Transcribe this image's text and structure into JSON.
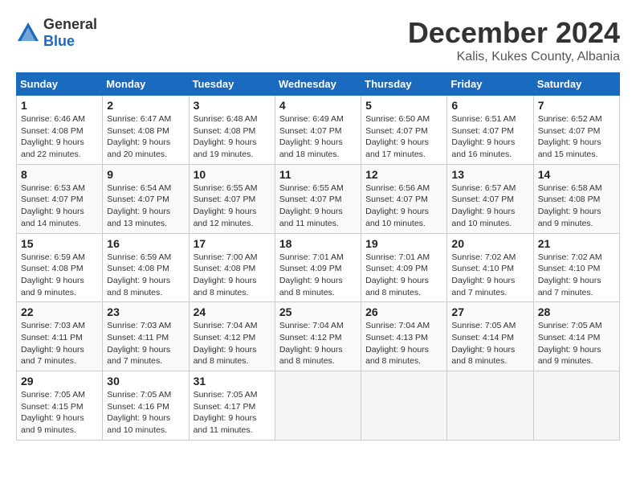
{
  "logo": {
    "general": "General",
    "blue": "Blue"
  },
  "title": {
    "month": "December 2024",
    "location": "Kalis, Kukes County, Albania"
  },
  "calendar": {
    "headers": [
      "Sunday",
      "Monday",
      "Tuesday",
      "Wednesday",
      "Thursday",
      "Friday",
      "Saturday"
    ],
    "rows": [
      [
        {
          "day": "1",
          "sunrise": "Sunrise: 6:46 AM",
          "sunset": "Sunset: 4:08 PM",
          "daylight": "Daylight: 9 hours and 22 minutes."
        },
        {
          "day": "2",
          "sunrise": "Sunrise: 6:47 AM",
          "sunset": "Sunset: 4:08 PM",
          "daylight": "Daylight: 9 hours and 20 minutes."
        },
        {
          "day": "3",
          "sunrise": "Sunrise: 6:48 AM",
          "sunset": "Sunset: 4:08 PM",
          "daylight": "Daylight: 9 hours and 19 minutes."
        },
        {
          "day": "4",
          "sunrise": "Sunrise: 6:49 AM",
          "sunset": "Sunset: 4:07 PM",
          "daylight": "Daylight: 9 hours and 18 minutes."
        },
        {
          "day": "5",
          "sunrise": "Sunrise: 6:50 AM",
          "sunset": "Sunset: 4:07 PM",
          "daylight": "Daylight: 9 hours and 17 minutes."
        },
        {
          "day": "6",
          "sunrise": "Sunrise: 6:51 AM",
          "sunset": "Sunset: 4:07 PM",
          "daylight": "Daylight: 9 hours and 16 minutes."
        },
        {
          "day": "7",
          "sunrise": "Sunrise: 6:52 AM",
          "sunset": "Sunset: 4:07 PM",
          "daylight": "Daylight: 9 hours and 15 minutes."
        }
      ],
      [
        {
          "day": "8",
          "sunrise": "Sunrise: 6:53 AM",
          "sunset": "Sunset: 4:07 PM",
          "daylight": "Daylight: 9 hours and 14 minutes."
        },
        {
          "day": "9",
          "sunrise": "Sunrise: 6:54 AM",
          "sunset": "Sunset: 4:07 PM",
          "daylight": "Daylight: 9 hours and 13 minutes."
        },
        {
          "day": "10",
          "sunrise": "Sunrise: 6:55 AM",
          "sunset": "Sunset: 4:07 PM",
          "daylight": "Daylight: 9 hours and 12 minutes."
        },
        {
          "day": "11",
          "sunrise": "Sunrise: 6:55 AM",
          "sunset": "Sunset: 4:07 PM",
          "daylight": "Daylight: 9 hours and 11 minutes."
        },
        {
          "day": "12",
          "sunrise": "Sunrise: 6:56 AM",
          "sunset": "Sunset: 4:07 PM",
          "daylight": "Daylight: 9 hours and 10 minutes."
        },
        {
          "day": "13",
          "sunrise": "Sunrise: 6:57 AM",
          "sunset": "Sunset: 4:07 PM",
          "daylight": "Daylight: 9 hours and 10 minutes."
        },
        {
          "day": "14",
          "sunrise": "Sunrise: 6:58 AM",
          "sunset": "Sunset: 4:08 PM",
          "daylight": "Daylight: 9 hours and 9 minutes."
        }
      ],
      [
        {
          "day": "15",
          "sunrise": "Sunrise: 6:59 AM",
          "sunset": "Sunset: 4:08 PM",
          "daylight": "Daylight: 9 hours and 9 minutes."
        },
        {
          "day": "16",
          "sunrise": "Sunrise: 6:59 AM",
          "sunset": "Sunset: 4:08 PM",
          "daylight": "Daylight: 9 hours and 8 minutes."
        },
        {
          "day": "17",
          "sunrise": "Sunrise: 7:00 AM",
          "sunset": "Sunset: 4:08 PM",
          "daylight": "Daylight: 9 hours and 8 minutes."
        },
        {
          "day": "18",
          "sunrise": "Sunrise: 7:01 AM",
          "sunset": "Sunset: 4:09 PM",
          "daylight": "Daylight: 9 hours and 8 minutes."
        },
        {
          "day": "19",
          "sunrise": "Sunrise: 7:01 AM",
          "sunset": "Sunset: 4:09 PM",
          "daylight": "Daylight: 9 hours and 8 minutes."
        },
        {
          "day": "20",
          "sunrise": "Sunrise: 7:02 AM",
          "sunset": "Sunset: 4:10 PM",
          "daylight": "Daylight: 9 hours and 7 minutes."
        },
        {
          "day": "21",
          "sunrise": "Sunrise: 7:02 AM",
          "sunset": "Sunset: 4:10 PM",
          "daylight": "Daylight: 9 hours and 7 minutes."
        }
      ],
      [
        {
          "day": "22",
          "sunrise": "Sunrise: 7:03 AM",
          "sunset": "Sunset: 4:11 PM",
          "daylight": "Daylight: 9 hours and 7 minutes."
        },
        {
          "day": "23",
          "sunrise": "Sunrise: 7:03 AM",
          "sunset": "Sunset: 4:11 PM",
          "daylight": "Daylight: 9 hours and 7 minutes."
        },
        {
          "day": "24",
          "sunrise": "Sunrise: 7:04 AM",
          "sunset": "Sunset: 4:12 PM",
          "daylight": "Daylight: 9 hours and 8 minutes."
        },
        {
          "day": "25",
          "sunrise": "Sunrise: 7:04 AM",
          "sunset": "Sunset: 4:12 PM",
          "daylight": "Daylight: 9 hours and 8 minutes."
        },
        {
          "day": "26",
          "sunrise": "Sunrise: 7:04 AM",
          "sunset": "Sunset: 4:13 PM",
          "daylight": "Daylight: 9 hours and 8 minutes."
        },
        {
          "day": "27",
          "sunrise": "Sunrise: 7:05 AM",
          "sunset": "Sunset: 4:14 PM",
          "daylight": "Daylight: 9 hours and 8 minutes."
        },
        {
          "day": "28",
          "sunrise": "Sunrise: 7:05 AM",
          "sunset": "Sunset: 4:14 PM",
          "daylight": "Daylight: 9 hours and 9 minutes."
        }
      ],
      [
        {
          "day": "29",
          "sunrise": "Sunrise: 7:05 AM",
          "sunset": "Sunset: 4:15 PM",
          "daylight": "Daylight: 9 hours and 9 minutes."
        },
        {
          "day": "30",
          "sunrise": "Sunrise: 7:05 AM",
          "sunset": "Sunset: 4:16 PM",
          "daylight": "Daylight: 9 hours and 10 minutes."
        },
        {
          "day": "31",
          "sunrise": "Sunrise: 7:05 AM",
          "sunset": "Sunset: 4:17 PM",
          "daylight": "Daylight: 9 hours and 11 minutes."
        },
        null,
        null,
        null,
        null
      ]
    ]
  }
}
